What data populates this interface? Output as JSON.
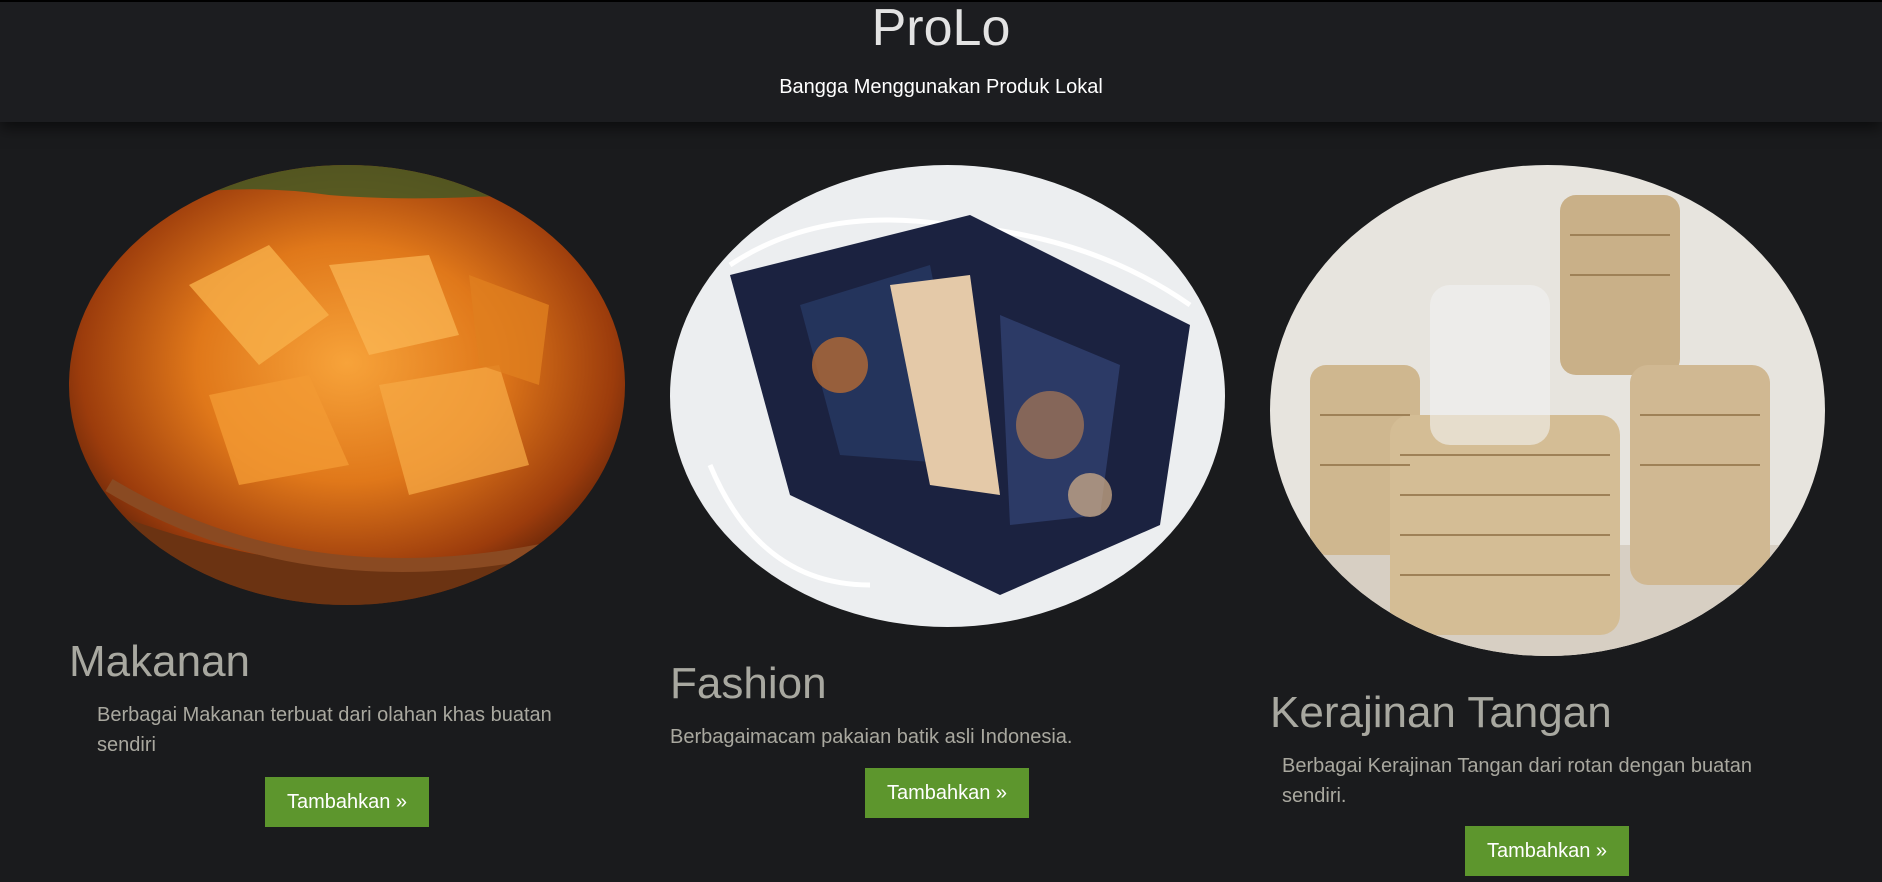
{
  "header": {
    "brand": "ProLo",
    "tagline": "Bangga Menggunakan Produk Lokal"
  },
  "cards": [
    {
      "title": "Makanan",
      "description": "Berbagai Makanan terbuat dari olahan khas buatan sendiri",
      "button_label": "Tambahkan »",
      "image_subject": "keripik food in woven basket"
    },
    {
      "title": "Fashion",
      "description": "Berbagaimacam pakaian batik asli Indonesia.",
      "button_label": "Tambahkan »",
      "image_subject": "batik face masks"
    },
    {
      "title": "Kerajinan Tangan",
      "description": "Berbagai Kerajinan Tangan dari rotan dengan buatan sendiri.",
      "button_label": "Tambahkan »",
      "image_subject": "rattan woven jugs"
    }
  ],
  "colors": {
    "background": "#1a1b1d",
    "button": "#5d962d",
    "title_text": "#a8a8a0"
  }
}
